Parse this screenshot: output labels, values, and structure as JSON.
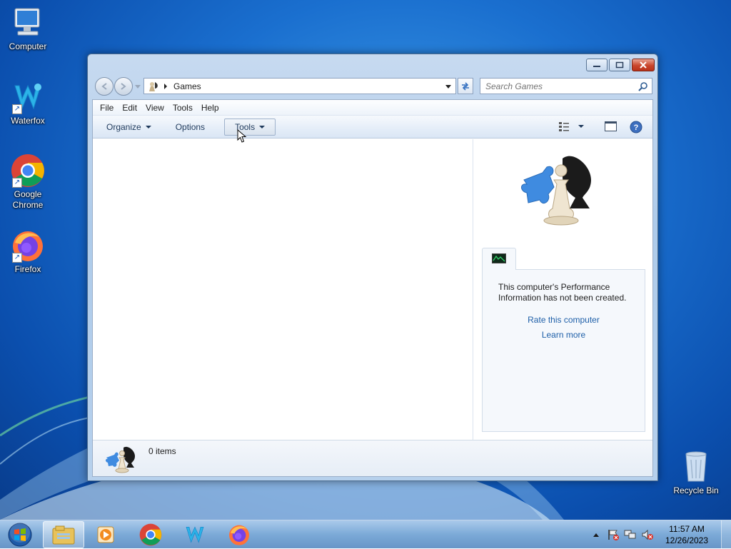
{
  "desktop": {
    "icons": [
      {
        "label": "Computer",
        "icon": "computer-icon"
      },
      {
        "label": "Waterfox",
        "icon": "waterfox-icon"
      },
      {
        "label": "Google Chrome",
        "icon": "chrome-icon"
      },
      {
        "label": "Firefox",
        "icon": "firefox-icon"
      },
      {
        "label": "Recycle Bin",
        "icon": "recycle-bin-icon"
      }
    ]
  },
  "window": {
    "address": {
      "location": "Games",
      "icon": "games-icon"
    },
    "search": {
      "placeholder": "Search Games"
    },
    "menu": [
      "File",
      "Edit",
      "View",
      "Tools",
      "Help"
    ],
    "commands": {
      "organize": "Organize",
      "options": "Options",
      "tools": "Tools"
    },
    "side_pane": {
      "performance_message": "This computer's Performance Information has not been created.",
      "rate_link": "Rate this computer",
      "learn_link": "Learn more"
    },
    "details": {
      "item_count": "0 items"
    }
  },
  "taskbar": {
    "items": [
      "start-orb",
      "windows-explorer",
      "windows-media-player",
      "google-chrome",
      "waterfox",
      "firefox"
    ],
    "clock": {
      "time": "11:57 AM",
      "date": "12/26/2023"
    }
  },
  "colors": {
    "link": "#1e5fa8",
    "desktop": "#1a6fcf",
    "close": "#c9462c"
  }
}
